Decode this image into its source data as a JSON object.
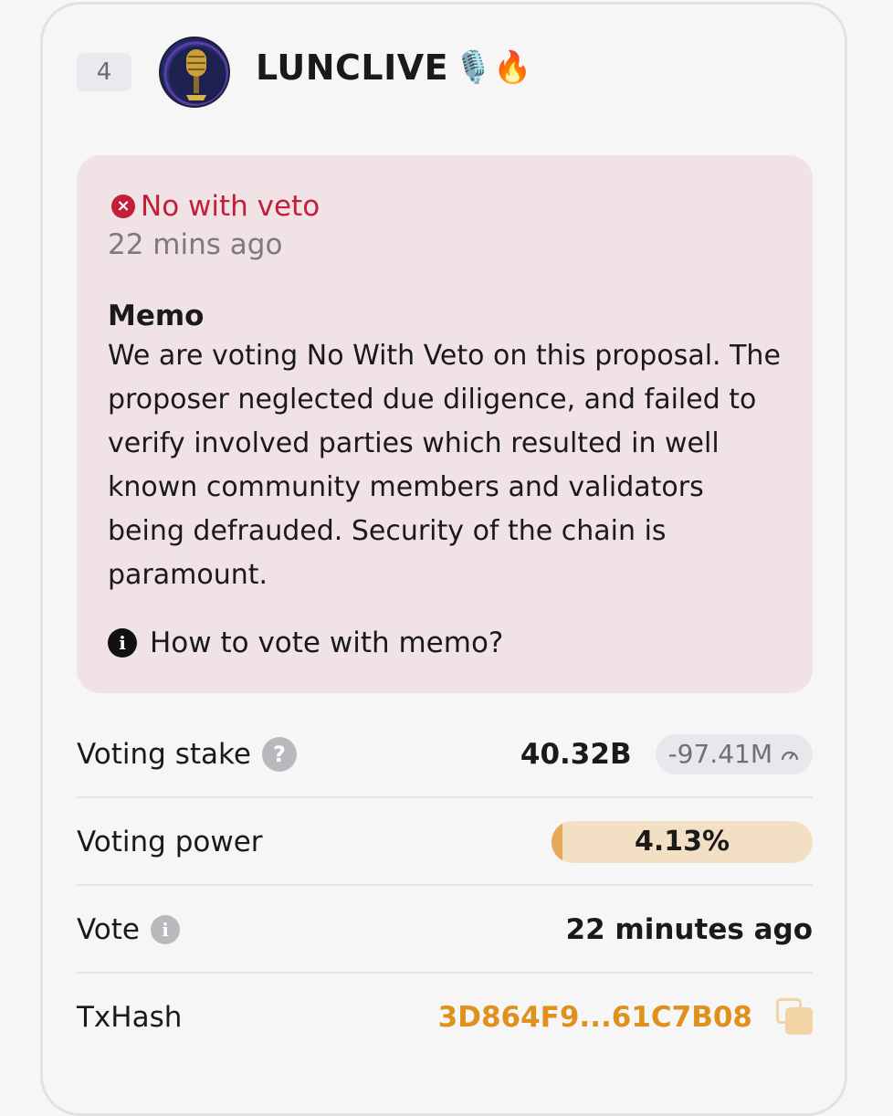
{
  "validator": {
    "rank": "4",
    "name": "LUNCLIVE",
    "name_emoji": "🎙️🔥"
  },
  "vote_card": {
    "status": "No with veto",
    "status_icon": "x-circle-icon",
    "time_ago": "22 mins ago",
    "memo_label": "Memo",
    "memo_text": "We are voting No With Veto on this proposal. The proposer neglected due diligence, and failed to verify involved parties which resulted in well known community members and validators being defrauded. Security of the chain is paramount.",
    "help_link": "How to vote with memo?"
  },
  "details": {
    "voting_stake": {
      "label": "Voting stake",
      "value": "40.32B",
      "change": "-97.41M"
    },
    "voting_power": {
      "label": "Voting power",
      "value": "4.13%",
      "fraction": 0.0413
    },
    "vote": {
      "label": "Vote",
      "value": "22 minutes ago"
    },
    "tx_hash": {
      "label": "TxHash",
      "value": "3D864F9...61C7B08"
    }
  },
  "colors": {
    "veto": "#c2203a",
    "memo_bg": "#f1e2e5",
    "accent": "#e0901c",
    "power_bar_bg": "#f3e0c4",
    "power_bar_fill": "#e6a85a"
  }
}
